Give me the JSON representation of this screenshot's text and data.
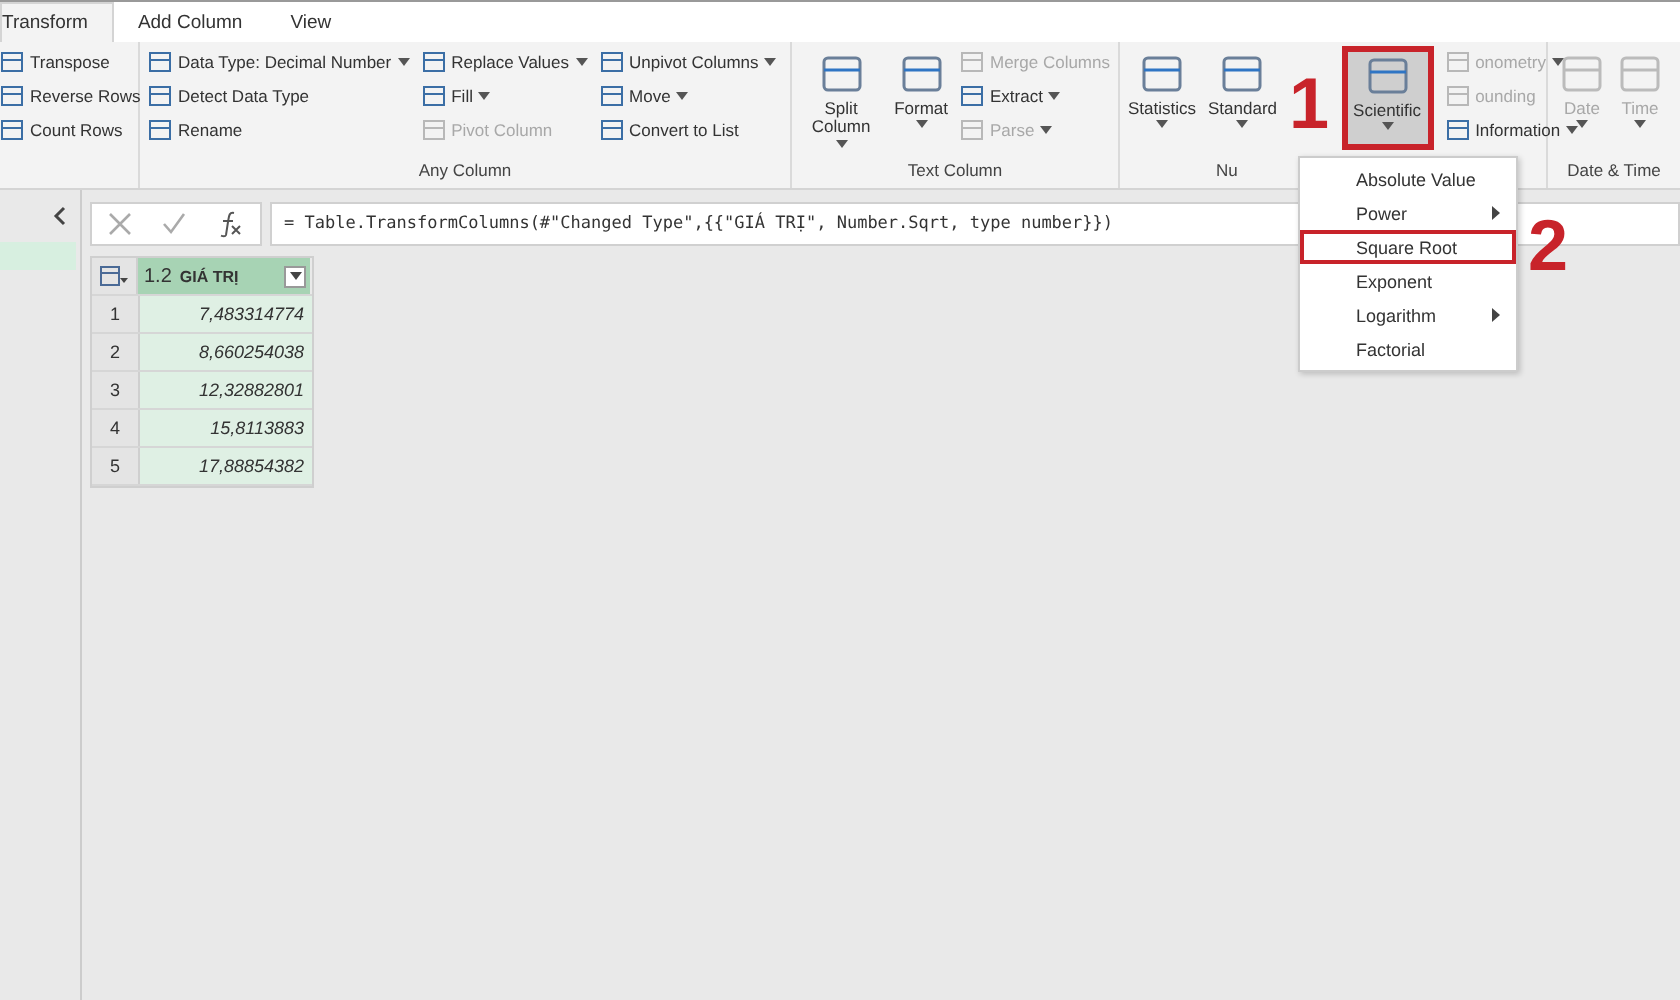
{
  "tabs": [
    {
      "label": "Transform",
      "selected": true
    },
    {
      "label": "Add Column",
      "selected": false
    },
    {
      "label": "View",
      "selected": false
    }
  ],
  "ribbon": {
    "groups": [
      {
        "columns": [
          [
            {
              "kind": "small",
              "label": "Transpose",
              "disabled": false,
              "dropdown": false
            },
            {
              "kind": "small",
              "label": "Reverse Rows",
              "disabled": false,
              "dropdown": false
            },
            {
              "kind": "small",
              "label": "Count Rows",
              "disabled": false,
              "dropdown": false
            }
          ]
        ]
      },
      {
        "label": "Any Column",
        "columns": [
          [
            {
              "kind": "small",
              "label": "Data Type: Decimal Number",
              "disabled": false,
              "dropdown": true
            },
            {
              "kind": "small",
              "label": "Detect Data Type",
              "disabled": false,
              "dropdown": false
            },
            {
              "kind": "small",
              "label": "Rename",
              "disabled": false,
              "dropdown": false
            }
          ],
          [
            {
              "kind": "small",
              "label": "Replace Values",
              "disabled": false,
              "dropdown": true
            },
            {
              "kind": "small",
              "label": "Fill",
              "disabled": false,
              "dropdown": true
            },
            {
              "kind": "small",
              "label": "Pivot Column",
              "disabled": true,
              "dropdown": false
            }
          ],
          [
            {
              "kind": "small",
              "label": "Unpivot Columns",
              "disabled": false,
              "dropdown": true
            },
            {
              "kind": "small",
              "label": "Move",
              "disabled": false,
              "dropdown": true
            },
            {
              "kind": "small",
              "label": "Convert to List",
              "disabled": false,
              "dropdown": false
            }
          ]
        ]
      },
      {
        "label": "Text Column",
        "columns": [
          [
            {
              "kind": "large",
              "label": "Split Column",
              "disabled": false,
              "dropdown": true,
              "highlighted": false
            }
          ],
          [
            {
              "kind": "large",
              "label": "Format",
              "disabled": false,
              "dropdown": true,
              "highlighted": false
            }
          ],
          [
            {
              "kind": "small",
              "label": "Merge Columns",
              "disabled": true,
              "dropdown": false
            },
            {
              "kind": "small",
              "label": "Extract",
              "disabled": false,
              "dropdown": true
            },
            {
              "kind": "small",
              "label": "Parse",
              "disabled": true,
              "dropdown": true
            }
          ]
        ]
      },
      {
        "label": "Nu",
        "columns": [
          [
            {
              "kind": "large",
              "label": "Statistics",
              "disabled": false,
              "dropdown": true,
              "highlighted": false
            }
          ],
          [
            {
              "kind": "large",
              "label": "Standard",
              "disabled": false,
              "dropdown": true,
              "highlighted": false
            }
          ],
          [
            {
              "kind": "large",
              "label": "Scientific",
              "disabled": false,
              "dropdown": true,
              "highlighted": true
            }
          ],
          [
            {
              "kind": "small",
              "label": "onometry",
              "disabled": true,
              "dropdown": true
            },
            {
              "kind": "small",
              "label": "ounding",
              "disabled": true,
              "dropdown": false
            },
            {
              "kind": "small",
              "label": "Information",
              "disabled": false,
              "dropdown": true
            }
          ]
        ]
      },
      {
        "label": "Date & Time",
        "columns": [
          [
            {
              "kind": "large",
              "label": "Date",
              "disabled": true,
              "dropdown": true,
              "highlighted": false
            }
          ],
          [
            {
              "kind": "large",
              "label": "Time",
              "disabled": true,
              "dropdown": true,
              "highlighted": false
            }
          ]
        ]
      }
    ]
  },
  "menu": [
    {
      "label": "Absolute Value",
      "submenu": false,
      "highlighted": false
    },
    {
      "label": "Power",
      "submenu": true,
      "highlighted": false
    },
    {
      "label": "Square Root",
      "submenu": false,
      "highlighted": true
    },
    {
      "label": "Exponent",
      "submenu": false,
      "highlighted": false
    },
    {
      "label": "Logarithm",
      "submenu": true,
      "highlighted": false
    },
    {
      "label": "Factorial",
      "submenu": false,
      "highlighted": false
    }
  ],
  "formula": "= Table.TransformColumns(#\"Changed Type\",{{\"GIÁ TRỊ\", Number.Sqrt, type number}})",
  "table": {
    "column": {
      "type": "1.2",
      "name": "GIÁ TRỊ"
    },
    "rows": [
      {
        "index": "1",
        "value": "7,483314774"
      },
      {
        "index": "2",
        "value": "8,660254038"
      },
      {
        "index": "3",
        "value": "12,32882801"
      },
      {
        "index": "4",
        "value": "15,8113883"
      },
      {
        "index": "5",
        "value": "17,88854382"
      }
    ]
  },
  "annotations": [
    "1",
    "2"
  ]
}
